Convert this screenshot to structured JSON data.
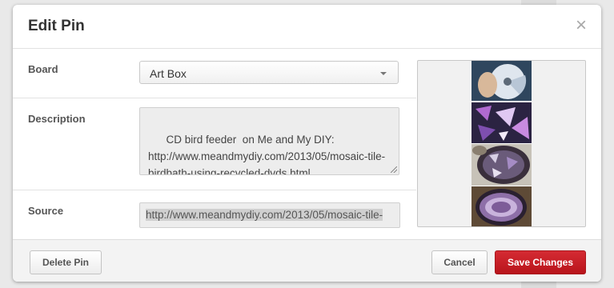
{
  "modal": {
    "title": "Edit Pin",
    "close_glyph": "×"
  },
  "form": {
    "board": {
      "label": "Board",
      "selected": "Art Box"
    },
    "description": {
      "label": "Description",
      "value": "CD bird feeder  on Me and My DIY: http://www.meandmydiy.com/2013/05/mosaic-tile-birdbath-using-recycled-dvds.html"
    },
    "source": {
      "label": "Source",
      "value": "http://www.meandmydiy.com/2013/05/mosaic-tile-"
    }
  },
  "footer": {
    "delete_label": "Delete Pin",
    "cancel_label": "Cancel",
    "save_label": "Save Changes"
  },
  "colors": {
    "primary_button": "#c8171e",
    "backdrop": "#e9e9e9"
  }
}
